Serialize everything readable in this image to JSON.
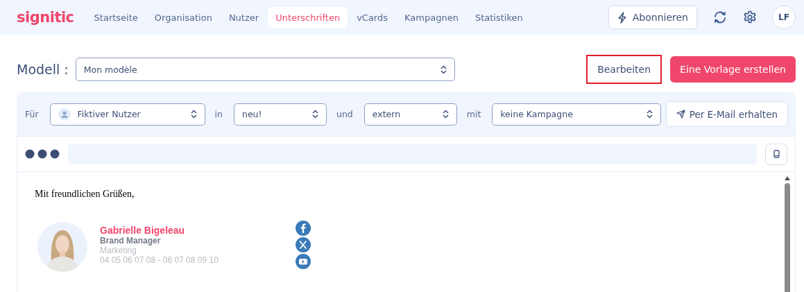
{
  "nav": {
    "logo": "signitic",
    "tabs": [
      {
        "label": "Startseite",
        "selected": false
      },
      {
        "label": "Organisation",
        "selected": false
      },
      {
        "label": "Nutzer",
        "selected": false
      },
      {
        "label": "Unterschriften",
        "selected": true
      },
      {
        "label": "vCards",
        "selected": false
      },
      {
        "label": "Kampagnen",
        "selected": false
      },
      {
        "label": "Statistiken",
        "selected": false
      }
    ],
    "subscribe": "Abonnieren",
    "avatar": "LF"
  },
  "model": {
    "label": "Modell :",
    "value": "Mon modèle",
    "edit": {
      "label": "Bearbeiten",
      "highlighted": true
    },
    "create": "Eine Vorlage erstellen"
  },
  "filters": [
    {
      "label": "Für",
      "value": "Fiktiver Nutzer",
      "kind": "user"
    },
    {
      "label": "in",
      "value": "neu!",
      "kind": "plain"
    },
    {
      "label": "und",
      "value": "extern",
      "kind": "plain"
    },
    {
      "label": "mit",
      "value": "keine Kampagne",
      "kind": "plain"
    }
  ],
  "send": "Per E-Mail erhalten",
  "preview": {
    "greeting": "Mit freundlichen Grüßen,",
    "name": "Gabrielle Bigeleau",
    "role": "Brand Manager",
    "department": "Marketing",
    "phone": "04 05 06 07 08 - 06 07 08 09 10"
  }
}
